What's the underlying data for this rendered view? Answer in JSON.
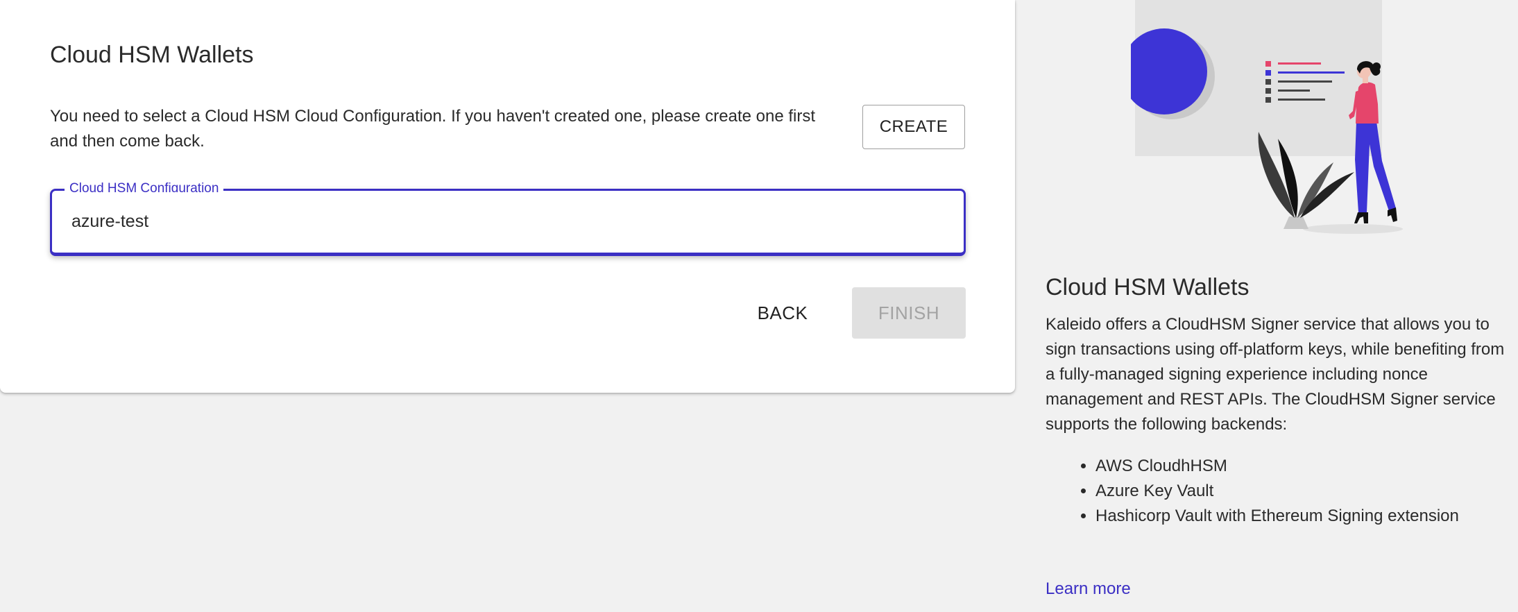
{
  "card": {
    "title": "Cloud HSM Wallets",
    "description": "You need to select a Cloud HSM Cloud Configuration. If you haven't created one, please create one first and then come back.",
    "create_label": "CREATE",
    "field_label": "Cloud HSM Configuration",
    "field_value": "azure-test",
    "back_label": "BACK",
    "finish_label": "FINISH"
  },
  "sidebar": {
    "title": "Cloud HSM Wallets",
    "description": "Kaleido offers a CloudHSM Signer service that allows you to sign transactions using off-platform keys, while benefiting from a fully-managed signing experience including nonce management and REST APIs. The CloudHSM Signer service supports the following backends:",
    "backends": [
      "AWS CloudhHSM",
      "Azure Key Vault",
      "Hashicorp Vault with Ethereum Signing extension"
    ],
    "learn_more": "Learn more"
  },
  "colors": {
    "accent": "#3b2fc4",
    "background": "#f1f1f1",
    "card": "#ffffff",
    "disabled_button": "#e0e0e0",
    "illustration_pink": "#e5456b"
  },
  "icons": {
    "illustration": "woman-presenting-illustration"
  }
}
